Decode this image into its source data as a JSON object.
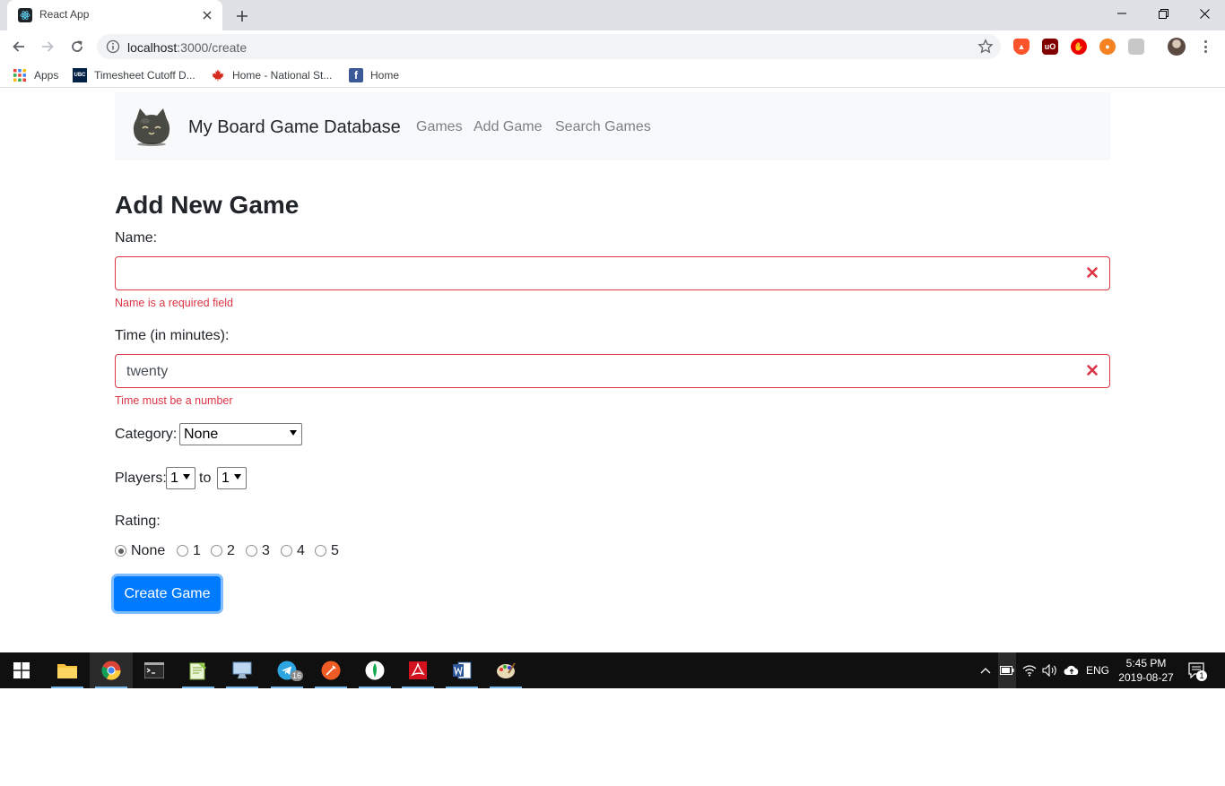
{
  "browser": {
    "tab_title": "React App",
    "url_host": "localhost",
    "url_path": ":3000/create",
    "bookmarks": [
      "Apps",
      "Timesheet Cutoff D...",
      "Home - National St...",
      "Home"
    ],
    "extension_icons": [
      "brave-shield-icon",
      "ublock-icon",
      "adblock-icon",
      "extension-orange-icon",
      "extension-gray-icon"
    ]
  },
  "navbar": {
    "brand": "My Board Game Database",
    "links": [
      "Games",
      "Add Game",
      "Search Games"
    ]
  },
  "form": {
    "title": "Add New Game",
    "name_label": "Name:",
    "name_value": "",
    "name_error": "Name is a required field",
    "time_label": "Time (in minutes):",
    "time_value": "twenty",
    "time_error": "Time must be a number",
    "category_label": "Category:",
    "category_value": "None",
    "players_label": "Players:",
    "players_min": "1",
    "players_to": "to",
    "players_max": "1",
    "rating_label": "Rating:",
    "rating_options": [
      "None",
      "1",
      "2",
      "3",
      "4",
      "5"
    ],
    "rating_selected": "None",
    "submit_label": "Create Game"
  },
  "colors": {
    "error": "#dc3545",
    "primary": "#007bff",
    "navbar_bg": "#f8f9fa"
  },
  "taskbar": {
    "apps": [
      "file-explorer-icon",
      "chrome-icon",
      "terminal-icon",
      "notepad-plus-icon",
      "remote-desktop-icon",
      "telegram-icon",
      "postman-icon",
      "mongodb-compass-icon",
      "acrobat-icon",
      "word-icon",
      "paint-icon"
    ],
    "telegram_badge": "16",
    "language": "ENG",
    "time": "5:45 PM",
    "date": "2019-08-27",
    "notification_count": "1"
  }
}
